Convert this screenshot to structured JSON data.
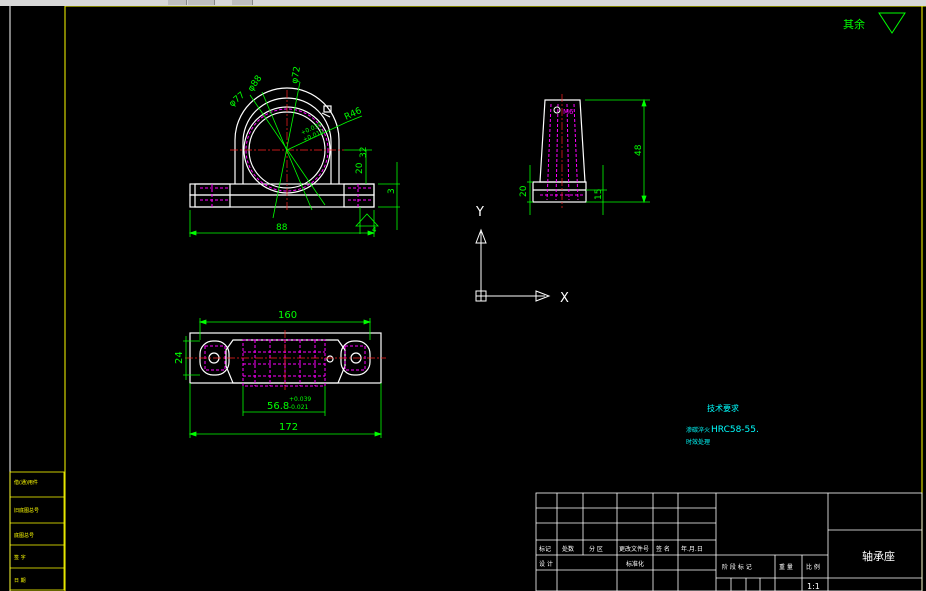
{
  "colors": {
    "background": "#000000",
    "frame": "#ffffff",
    "part_outline": "#ffffff",
    "dimension": "#00ff00",
    "hidden": "#ff00ff",
    "center": "#ff2020",
    "text_green": "#00ff00",
    "text_yellow": "#ffff00",
    "note_text": "#00ffff"
  },
  "app": {
    "toolbar_strip": "toolbar"
  },
  "front_view": {
    "dim_phi77": "φ77",
    "dim_phi88": "φ88",
    "dim_phi72": "φ72",
    "dim_r46": "R46",
    "dim_32": "32",
    "dim_20": "20",
    "dim_88": "88",
    "dim_3": "3",
    "dim_small": "4",
    "tol_upper": "+0.030",
    "tol_lower": "+0.010"
  },
  "side_view": {
    "dim_48": "48",
    "dim_20": "20",
    "dim_15": "15",
    "label": "M6"
  },
  "top_view": {
    "dim_160": "160",
    "dim_24": "24",
    "dim_172": "172",
    "dim_568": "56.8",
    "tol_upper": "+0.039",
    "tol_lower": "-0.021"
  },
  "ucs": {
    "x_label": "X",
    "y_label": "Y"
  },
  "roughness": {
    "label": "其余"
  },
  "notes": {
    "title": "技术要求",
    "line1_prefix": "渗碳淬火",
    "line1_value": "HRC58-55.",
    "line2": "时效处理"
  },
  "left_table": {
    "row1": "借(通)用件",
    "row2": "旧底图总号",
    "row3": "底图总号",
    "row4": "签 字",
    "row5": "日 期"
  },
  "title_block": {
    "part_name": "轴承座",
    "h_mark": "标记",
    "h_count": "处数",
    "h_zone": "分 区",
    "h_docno": "更改文件号",
    "h_sign": "签 名",
    "h_date": "年.月.日",
    "h_design": "设 计",
    "h_std": "标准化",
    "h_stage": "阶 段 标 记",
    "h_weight": "重 量",
    "h_scale": "比 例",
    "scale_value": "1:1"
  }
}
